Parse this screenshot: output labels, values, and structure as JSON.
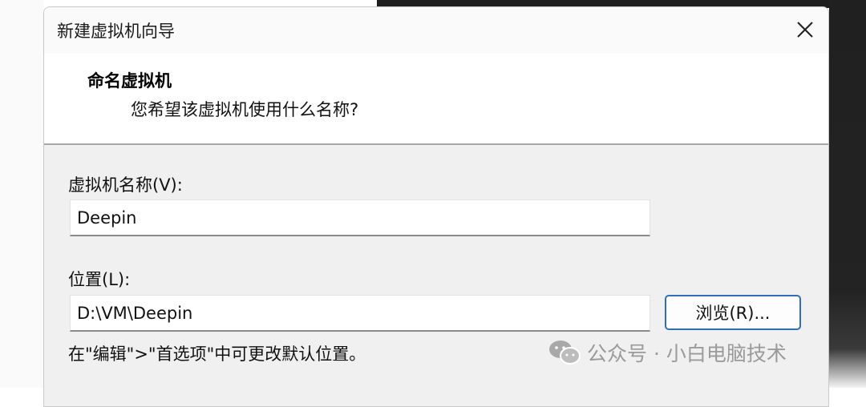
{
  "window": {
    "title": "新建虚拟机向导",
    "close_icon": "close-icon"
  },
  "header": {
    "title": "命名虚拟机",
    "subtitle": "您希望该虚拟机使用什么名称?"
  },
  "form": {
    "vm_name_label": "虚拟机名称(V):",
    "vm_name_value": "Deepin",
    "location_label": "位置(L):",
    "location_value": "D:\\VM\\Deepin",
    "browse_label": "浏览(R)...",
    "hint": "在\"编辑\">\"首选项\"中可更改默认位置。"
  },
  "watermark": {
    "icon": "wechat-icon",
    "text": "公众号 · 小白电脑技术"
  }
}
